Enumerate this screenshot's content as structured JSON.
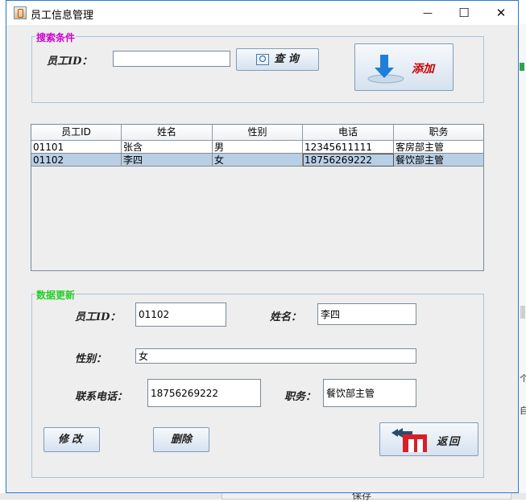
{
  "window": {
    "title": "员工信息管理",
    "minimize": "—",
    "maximize": "☐",
    "close": "✕"
  },
  "search": {
    "legend": "搜索条件",
    "employee_id_label": "员工ID：",
    "employee_id_value": "",
    "query_button": "查 询",
    "add_button": "添加"
  },
  "table": {
    "columns": [
      "员工ID",
      "姓名",
      "性别",
      "电话",
      "职务"
    ],
    "rows": [
      [
        "01101",
        "张含",
        "男",
        "12345611111",
        "客房部主管"
      ],
      [
        "01102",
        "李四",
        "女",
        "18756269222",
        "餐饮部主管"
      ]
    ],
    "selected_row": 1
  },
  "update": {
    "legend": "数据更新",
    "employee_id_label": "员工ID：",
    "employee_id_value": "01102",
    "name_label": "姓名：",
    "name_value": "李四",
    "gender_label": "性别：",
    "gender_value": "女",
    "phone_label": "联系电话：",
    "phone_value": "18756269222",
    "position_label": "职务：",
    "position_value": "餐饮部主管",
    "modify_button": "修改",
    "delete_button": "删除",
    "back_button": "返回"
  },
  "background": {
    "save_text": "保存",
    "edge_char_1": "个",
    "edge_char_2": "自"
  },
  "colors": {
    "search_legend": "#cc00cc",
    "update_legend": "#22cc22",
    "add_text": "#cc0000",
    "selected_row": "#b8cfe5",
    "border_blue": "#2b79d1"
  }
}
